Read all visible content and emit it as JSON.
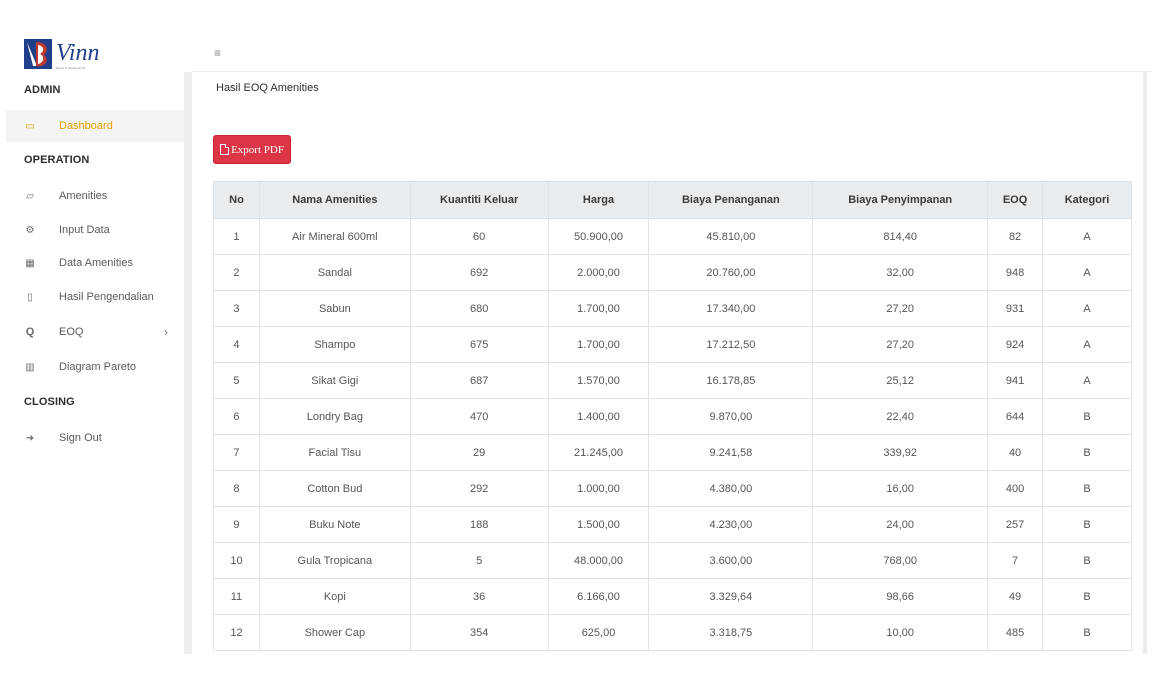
{
  "sidebar": {
    "logo_text": "Vinn",
    "logo_subtitle": "Hotel & Apartments",
    "sections": {
      "admin": "ADMIN",
      "operation": "OPERATION",
      "closing": "CLOSING"
    },
    "items": [
      {
        "label": "Dashboard",
        "icon": "laptop-icon",
        "active": true
      },
      {
        "label": "Amenities",
        "icon": "folder-icon"
      },
      {
        "label": "Input Data",
        "icon": "cogs-icon"
      },
      {
        "label": "Data Amenities",
        "icon": "table-icon"
      },
      {
        "label": "Hasil Pengendalian",
        "icon": "file-icon"
      },
      {
        "label": "EOQ",
        "icon": "q-icon",
        "has_submenu": true
      },
      {
        "label": "Diagram Pareto",
        "icon": "bar-chart-icon"
      },
      {
        "label": "Sign Out",
        "icon": "sign-out-icon"
      }
    ]
  },
  "main": {
    "title": "Hasil EOQ Amenities",
    "export_label": "Export PDF",
    "export_color": "#dc3545",
    "table": {
      "headers": [
        "No",
        "Nama Amenities",
        "Kuantiti Keluar",
        "Harga",
        "Biaya Penanganan",
        "Biaya Penyimpanan",
        "EOQ",
        "Kategori"
      ],
      "rows": [
        [
          "1",
          "Air Mineral 600ml",
          "60",
          "50.900,00",
          "45.810,00",
          "814,40",
          "82",
          "A"
        ],
        [
          "2",
          "Sandal",
          "692",
          "2.000,00",
          "20.760,00",
          "32,00",
          "948",
          "A"
        ],
        [
          "3",
          "Sabun",
          "680",
          "1.700,00",
          "17.340,00",
          "27,20",
          "931",
          "A"
        ],
        [
          "4",
          "Shampo",
          "675",
          "1.700,00",
          "17.212,50",
          "27,20",
          "924",
          "A"
        ],
        [
          "5",
          "Sikat Gigi",
          "687",
          "1.570,00",
          "16.178,85",
          "25,12",
          "941",
          "A"
        ],
        [
          "6",
          "Londry Bag",
          "470",
          "1.400,00",
          "9.870,00",
          "22,40",
          "644",
          "B"
        ],
        [
          "7",
          "Facial Tisu",
          "29",
          "21.245,00",
          "9.241,58",
          "339,92",
          "40",
          "B"
        ],
        [
          "8",
          "Cotton Bud",
          "292",
          "1.000,00",
          "4.380,00",
          "16,00",
          "400",
          "B"
        ],
        [
          "9",
          "Buku Note",
          "188",
          "1.500,00",
          "4.230,00",
          "24,00",
          "257",
          "B"
        ],
        [
          "10",
          "Gula Tropicana",
          "5",
          "48.000,00",
          "3.600,00",
          "768,00",
          "7",
          "B"
        ],
        [
          "11",
          "Kopi",
          "36",
          "6.166,00",
          "3.329,64",
          "98,66",
          "49",
          "B"
        ],
        [
          "12",
          "Shower Cap",
          "354",
          "625,00",
          "3.318,75",
          "10,00",
          "485",
          "B"
        ]
      ]
    }
  }
}
